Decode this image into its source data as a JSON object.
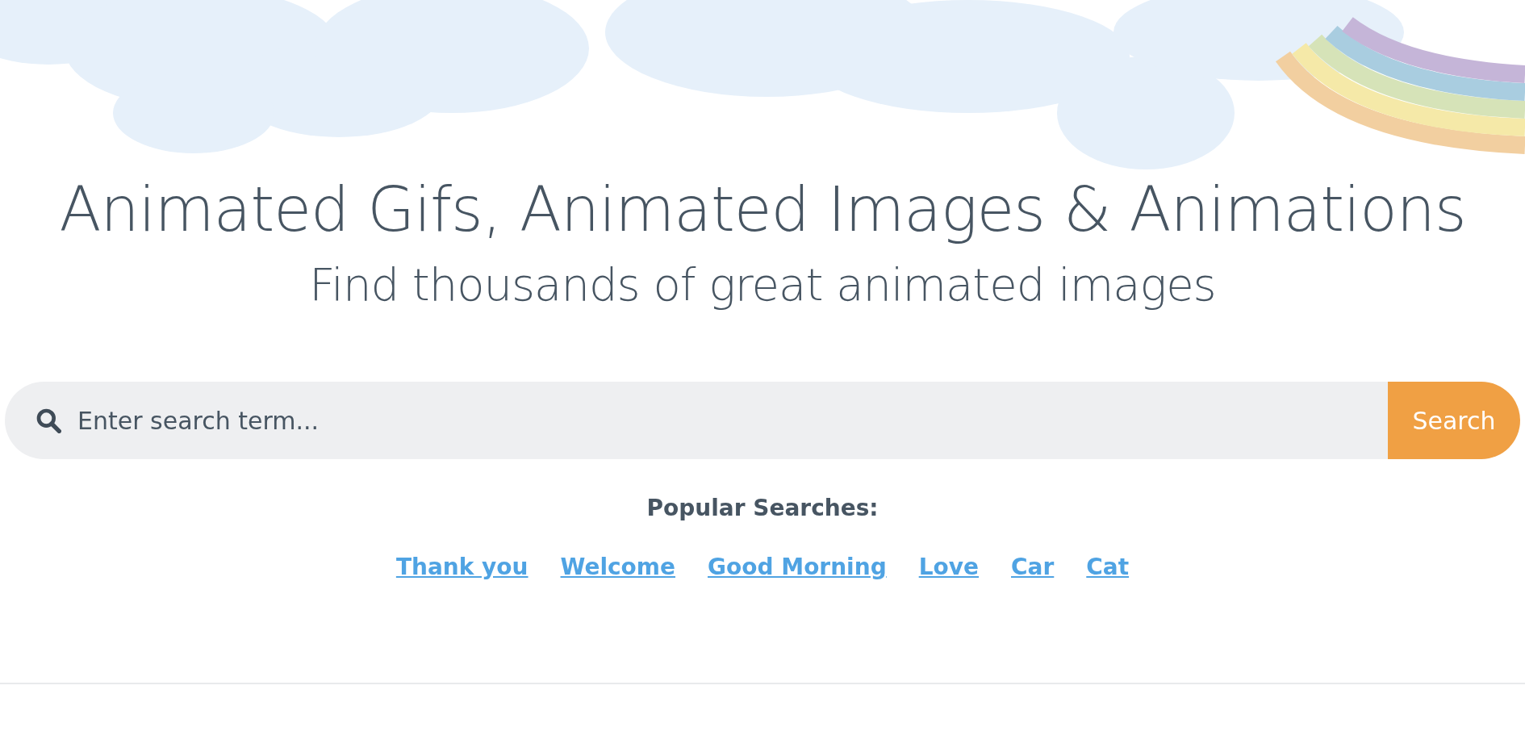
{
  "hero": {
    "title": "Animated Gifs, Animated Images & Animations",
    "subtitle": "Find thousands of great animated images"
  },
  "search": {
    "placeholder": "Enter search term...",
    "button": "Search"
  },
  "popular": {
    "label": "Popular Searches:",
    "links": [
      "Thank you",
      "Welcome",
      "Good Morning",
      "Love",
      "Car",
      "Cat"
    ]
  }
}
